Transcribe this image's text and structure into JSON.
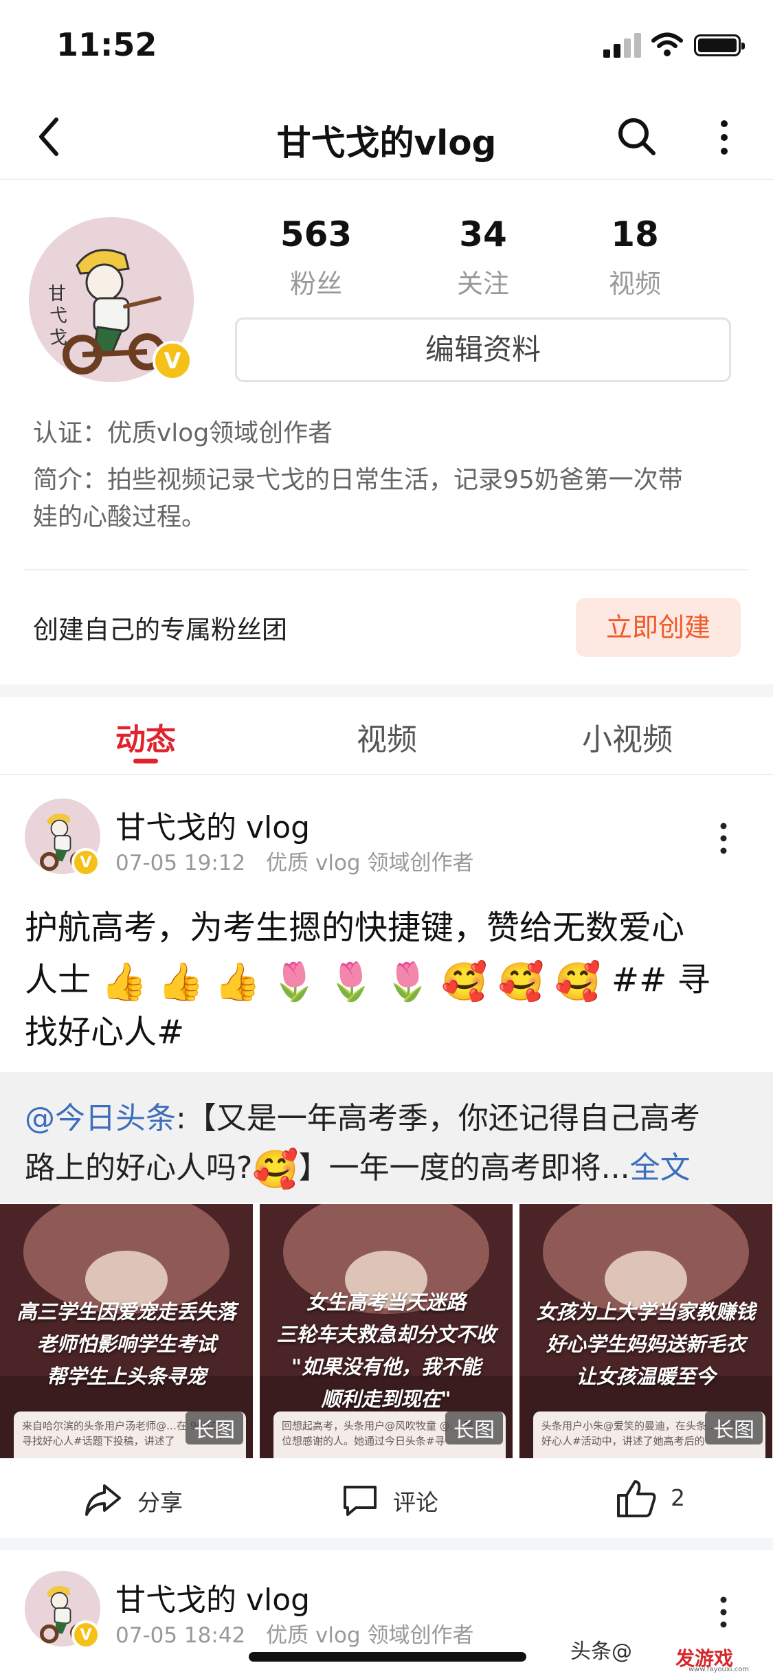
{
  "status_bar": {
    "time": "11:52"
  },
  "nav": {
    "title": "甘弋戈的vlog",
    "icons": [
      "back-icon",
      "search-icon",
      "more-icon"
    ]
  },
  "profile": {
    "stats": [
      {
        "value": "563",
        "label": "粉丝"
      },
      {
        "value": "34",
        "label": "关注"
      },
      {
        "value": "18",
        "label": "视频"
      }
    ],
    "verified_badge": "V",
    "edit_button": "编辑资料",
    "certification": "认证：优质vlog领域创作者",
    "bio_line1": "简介：拍些视频记录弋戈的日常生活，记录95奶爸第一次带",
    "bio_line2": "娃的心酸过程。"
  },
  "fan_group": {
    "text": "创建自己的专属粉丝团",
    "button": "立即创建"
  },
  "tabs": [
    {
      "label": "动态",
      "active": true
    },
    {
      "label": "视频",
      "active": false
    },
    {
      "label": "小视频",
      "active": false
    }
  ],
  "post": {
    "author": "甘弋戈的 vlog",
    "time": "07-05 19:12",
    "category": "优质 vlog 领域创作者",
    "text_line1": "护航高考，为考生摁的快捷键，赞给无数爱心",
    "text_prefix2": "人士",
    "emoji_row": [
      "👍",
      "👍",
      "👍",
      "🌷",
      "🌷",
      "🌷",
      "🥰",
      "🥰",
      "🥰"
    ],
    "text_suffix2": "## 寻",
    "text_line3": "找好心人#",
    "quote": {
      "mention": "@今日头条",
      "body1": ":【又是一年高考季，你还记得自己高考",
      "body2": "路上的好心人吗?",
      "emoji": "🥰",
      "body3": "】一年一度的高考即将...",
      "more": "全文"
    },
    "images": [
      {
        "caption": [
          "高三学生因爱宠走丢失落",
          "老师怕影响学生考试",
          "帮学生上头条寻宠"
        ],
        "snippet": "来自哈尔滨的头条用户汤老师@…在 966在#寻找好心人#话题下投稿，讲述了",
        "tag": "长图"
      },
      {
        "caption": [
          "女生高考当天迷路",
          "三轮车夫救急却分文不收",
          "\"如果没有他，我不能",
          "顺利走到现在\""
        ],
        "snippet": "回想起高考，头条用户@风吹牧童 @… 里有一位想感谢的人。她通过今日头条#寻",
        "tag": "长图"
      },
      {
        "caption": [
          "女孩为上大学当家教赚钱",
          "好心学生妈妈送新毛衣",
          "让女孩温暖至今"
        ],
        "snippet": "头条用户小朱@爱笑的曼迪，在头条… #寻找好心人#活动中，讲述了她高考后的",
        "tag": "长图"
      }
    ],
    "actions": {
      "share": "分享",
      "comment": "评论",
      "like_count": "2"
    }
  },
  "post2": {
    "author": "甘弋戈的 vlog",
    "time": "07-05 18:42",
    "category": "优质 vlog 领域创作者"
  },
  "overlay": {
    "watermark": "头条@",
    "logo": "发游戏",
    "logo_url": "www.fayouxi.com"
  }
}
